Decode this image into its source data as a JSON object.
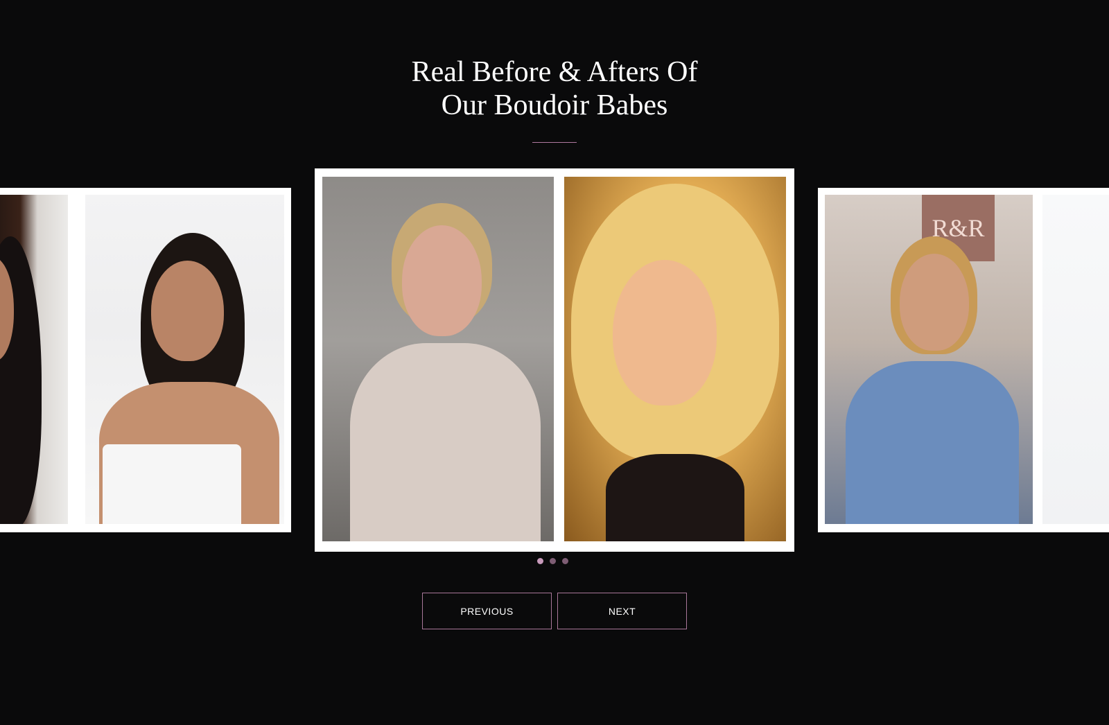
{
  "section": {
    "title_line1": "Real Before & Afters Of",
    "title_line2": "Our Boudoir Babes"
  },
  "carousel": {
    "slides": [
      {
        "position": "previous",
        "before_alt": "before photo",
        "after_alt": "after photo"
      },
      {
        "position": "current",
        "before_alt": "before photo",
        "after_alt": "after photo"
      },
      {
        "position": "next",
        "before_alt": "before photo",
        "after_alt": "after photo",
        "sign_text": "R&R"
      }
    ],
    "dots": 3,
    "active_dot": 1
  },
  "buttons": {
    "previous_label": "PREVIOUS",
    "next_label": "NEXT"
  },
  "colors": {
    "background": "#0a0a0b",
    "accent": "#b07aa1"
  }
}
